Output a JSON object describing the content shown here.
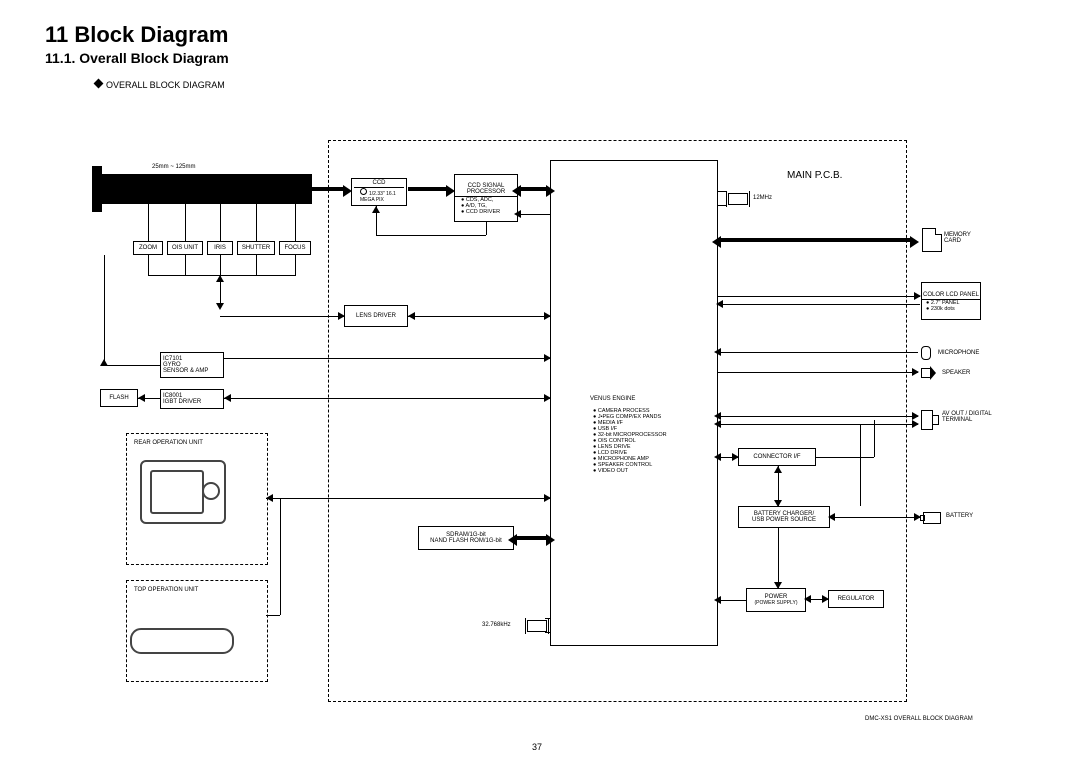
{
  "headings": {
    "chapter": "11 Block Diagram",
    "section": "11.1.   Overall Block Diagram",
    "subheader": "OVERALL BLOCK DIAGRAM"
  },
  "main_pcb_label": "MAIN P.C.B.",
  "lens": {
    "range": "25mm ~ 125mm",
    "units": [
      "ZOOM",
      "OIS UNIT",
      "IRIS",
      "SHUTTER",
      "FOCUS"
    ]
  },
  "blocks": {
    "ccd": "CCD",
    "ccd_spec": "1/2.33\" 16.1 MEGA PIX",
    "ccd_sig": "CCD SIGNAL PROCESSOR",
    "ccd_sig_items": [
      "CDS, ADC,",
      "A/D, TG,",
      "CCD DRIVER"
    ],
    "lens_driver": "LENS DRIVER",
    "gyro_ic": "IC7101",
    "gyro": "GYRO",
    "gyro2": "SENSOR & AMP",
    "flash": "FLASH",
    "igbt_ic": "IC8001",
    "igbt": "IGBT DRIVER",
    "rear_op": "REAR OPERATION UNIT",
    "top_op": "TOP OPERATION UNIT",
    "venus": "VENUS ENGINE",
    "venus_items": [
      "CAMERA PROCESS",
      "J•PEG COMP/EX PANDS",
      "MEDIA I/F",
      "USB I/F",
      "32-bit MICROPROCESSOR",
      "OIS CONTROL",
      "LENS DRIVE",
      "LCD DRIVE",
      "MICROPHONE AMP",
      "SPEAKER CONTROL",
      "VIDEO OUT"
    ],
    "sdram1": "SDRAM/1G-bit",
    "sdram2": "NAND FLASH ROM/1G-bit",
    "connector_if": "CONNECTOR I/F",
    "batt_chg1": "BATTERY CHARGER/",
    "batt_chg2": "USB POWER SOURCE",
    "power": "POWER",
    "power_sub": "(POWER SUPPLY)",
    "regulator": "REGULATOR",
    "clock1": "12MHz",
    "clock2": "32.768kHz",
    "memory_card": "MEMORY CARD",
    "lcd": "COLOR LCD PANEL",
    "lcd_items": [
      "2.7\" PANEL",
      "230k dots"
    ],
    "microphone": "MICROPHONE",
    "speaker": "SPEAKER",
    "avout": "AV OUT / DIGITAL TERMINAL",
    "battery": "BATTERY"
  },
  "footer_note": "DMC-XS1 OVERALL BLOCK DIAGRAM",
  "page_number": "37"
}
